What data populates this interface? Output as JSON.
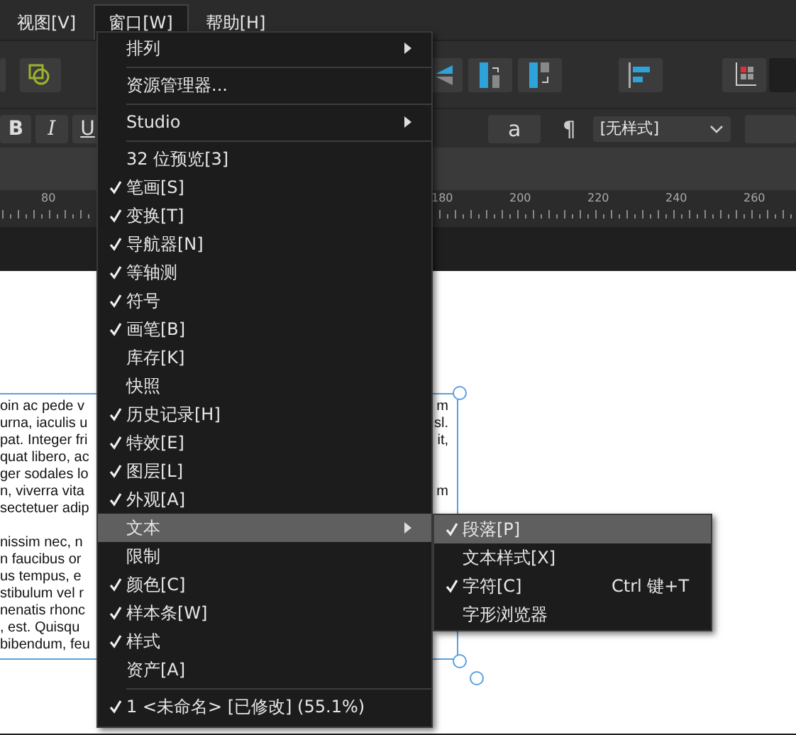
{
  "menu_bar": [
    {
      "label": "视图[V]",
      "selected": false
    },
    {
      "label": "窗口[W]",
      "selected": true
    },
    {
      "label": "帮助[H]",
      "selected": false
    }
  ],
  "format_bar": {
    "bold": "B",
    "italic": "I",
    "underline": "U",
    "case_button": "a",
    "pilcrow": "¶",
    "style_dropdown": "[无样式]"
  },
  "ruler": {
    "labels": [
      "80",
      "180",
      "200",
      "220",
      "240",
      "260"
    ]
  },
  "document": {
    "paragraphs": [
      {
        "lines": [
          {
            "left": "oin ac pede v",
            "right": "m"
          },
          {
            "left": "urna, iaculis u",
            "right": "sl."
          },
          {
            "left": "pat. Integer fri",
            "right": "it,"
          },
          {
            "left": "quat libero, ac"
          },
          {
            "left": "ger sodales lo"
          },
          {
            "left": "n, viverra vita",
            "right": "m"
          },
          {
            "left": "sectetuer adip"
          }
        ]
      },
      {
        "lines": [
          {
            "left": "nissim nec, n"
          },
          {
            "left": "n faucibus or"
          },
          {
            "left": "us tempus, e"
          },
          {
            "left": "stibulum vel r"
          },
          {
            "left": "nenatis rhonc"
          },
          {
            "left": ", est. Quisqu"
          },
          {
            "left": "bibendum, feu"
          }
        ]
      }
    ]
  },
  "window_menu": {
    "items": [
      {
        "kind": "item",
        "label": "排列",
        "checked": false,
        "submenu": true,
        "selected": false
      },
      {
        "kind": "separator"
      },
      {
        "kind": "item",
        "label": "资源管理器...",
        "checked": false,
        "submenu": false,
        "selected": false
      },
      {
        "kind": "separator"
      },
      {
        "kind": "item",
        "label": "Studio",
        "checked": false,
        "submenu": true,
        "selected": false
      },
      {
        "kind": "separator"
      },
      {
        "kind": "item",
        "label": "32 位预览[3]",
        "checked": false,
        "submenu": false,
        "selected": false
      },
      {
        "kind": "item",
        "label": "笔画[S]",
        "checked": true,
        "submenu": false,
        "selected": false
      },
      {
        "kind": "item",
        "label": "变换[T]",
        "checked": true,
        "submenu": false,
        "selected": false
      },
      {
        "kind": "item",
        "label": "导航器[N]",
        "checked": true,
        "submenu": false,
        "selected": false
      },
      {
        "kind": "item",
        "label": "等轴测",
        "checked": true,
        "submenu": false,
        "selected": false
      },
      {
        "kind": "item",
        "label": "符号",
        "checked": true,
        "submenu": false,
        "selected": false
      },
      {
        "kind": "item",
        "label": "画笔[B]",
        "checked": true,
        "submenu": false,
        "selected": false
      },
      {
        "kind": "item",
        "label": "库存[K]",
        "checked": false,
        "submenu": false,
        "selected": false
      },
      {
        "kind": "item",
        "label": "快照",
        "checked": false,
        "submenu": false,
        "selected": false
      },
      {
        "kind": "item",
        "label": "历史记录[H]",
        "checked": true,
        "submenu": false,
        "selected": false
      },
      {
        "kind": "item",
        "label": "特效[E]",
        "checked": true,
        "submenu": false,
        "selected": false
      },
      {
        "kind": "item",
        "label": "图层[L]",
        "checked": true,
        "submenu": false,
        "selected": false
      },
      {
        "kind": "item",
        "label": "外观[A]",
        "checked": true,
        "submenu": false,
        "selected": false
      },
      {
        "kind": "item",
        "label": "文本",
        "checked": false,
        "submenu": true,
        "selected": true
      },
      {
        "kind": "item",
        "label": "限制",
        "checked": false,
        "submenu": false,
        "selected": false
      },
      {
        "kind": "item",
        "label": "颜色[C]",
        "checked": true,
        "submenu": false,
        "selected": false
      },
      {
        "kind": "item",
        "label": "样本条[W]",
        "checked": true,
        "submenu": false,
        "selected": false
      },
      {
        "kind": "item",
        "label": "样式",
        "checked": true,
        "submenu": false,
        "selected": false
      },
      {
        "kind": "item",
        "label": "资产[A]",
        "checked": false,
        "submenu": false,
        "selected": false
      },
      {
        "kind": "separator"
      },
      {
        "kind": "item",
        "label": "1 <未命名> [已修改] (55.1%)",
        "checked": true,
        "submenu": false,
        "selected": false
      }
    ]
  },
  "text_submenu": {
    "items": [
      {
        "label": "段落[P]",
        "checked": true,
        "selected": true
      },
      {
        "label": "文本样式[X]",
        "checked": false,
        "selected": false
      },
      {
        "label": "字符[C]",
        "checked": true,
        "selected": false,
        "shortcut": "Ctrl 键+T"
      },
      {
        "label": "字形浏览器",
        "checked": false,
        "selected": false
      }
    ]
  }
}
